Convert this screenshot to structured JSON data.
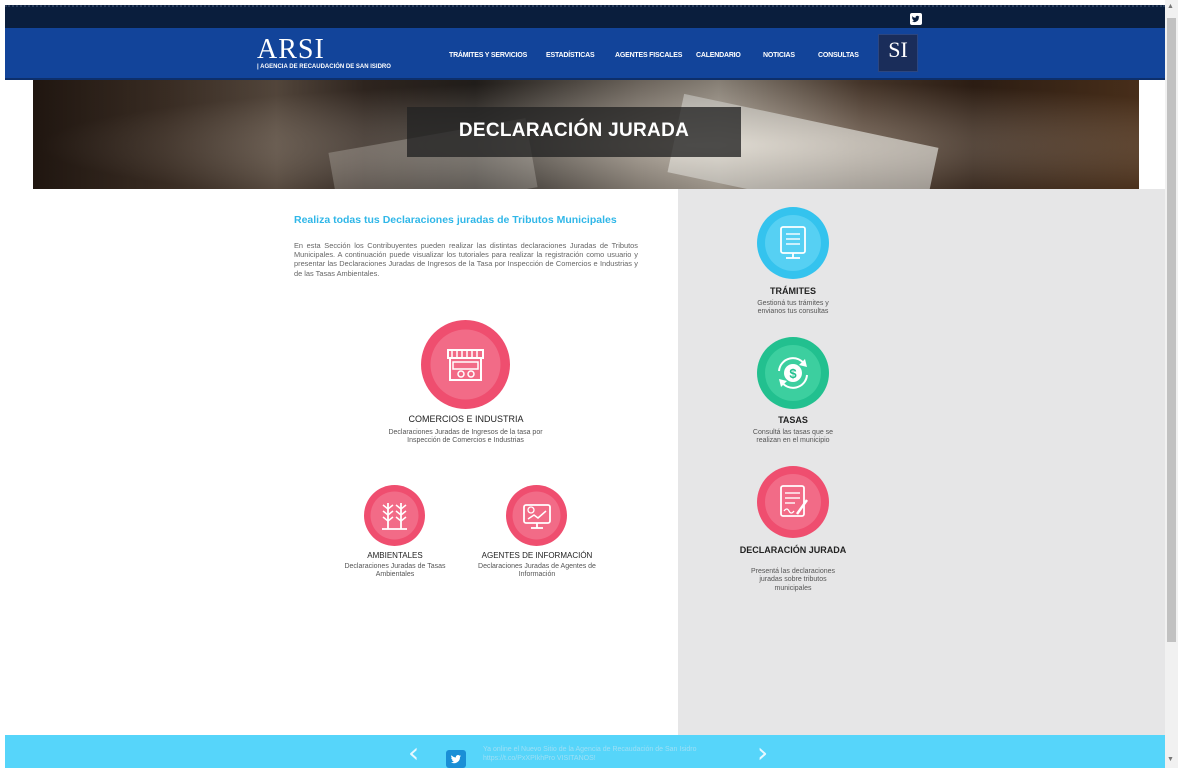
{
  "topbar": {
    "social_icon": "twitter-icon"
  },
  "header": {
    "logo_title": "ARSI",
    "logo_subtitle": "| AGENCIA DE RECAUDACIÓN DE SAN ISIDRO",
    "nav": [
      {
        "label": "TRÁMITES Y SERVICIOS"
      },
      {
        "label": "ESTADÍSTICAS"
      },
      {
        "label": "AGENTES FISCALES"
      },
      {
        "label": "CALENDARIO"
      },
      {
        "label": "NOTICIAS"
      },
      {
        "label": "CONSULTAS"
      }
    ],
    "si_logo": "SI"
  },
  "hero": {
    "title": "DECLARACIÓN JURADA"
  },
  "main": {
    "heading": "Realiza todas tus Declaraciones juradas de Tributos Municipales",
    "intro": "En esta Sección los Contribuyentes pueden realizar las distintas declaraciones Juradas de Tributos Municipales. A continuación puede visualizar los tutoriales para realizar la registración como usuario y presentar las Declaraciones Juradas de Ingresos de la Tasa por Inspección de Comercios e Industrias y de las Tasas Ambientales.",
    "cards": [
      {
        "title": "COMERCIOS E INDUSTRIA",
        "desc": "Declaraciones Juradas de Ingresos de la tasa por Inspección de Comercios e Industrias",
        "icon": "store-icon"
      },
      {
        "title": "AMBIENTALES",
        "desc": "Declaraciones Juradas de Tasas Ambientales",
        "icon": "plants-icon"
      },
      {
        "title": "AGENTES DE INFORMACIÓN",
        "desc": "Declaraciones Juradas de Agentes de Información",
        "icon": "monitor-info-icon"
      }
    ]
  },
  "sidebar": {
    "items": [
      {
        "title": "TRÁMITES",
        "desc": "Gestioná tus trámites y envianos tus consultas",
        "icon": "document-monitor-icon",
        "color": "#34c3ee"
      },
      {
        "title": "TASAS",
        "desc": "Consultá las tasas que se realizan en el municipio",
        "icon": "dollar-refresh-icon",
        "color": "#22c08f"
      },
      {
        "title": "DECLARACIÓN JURADA",
        "desc": "Presentá las declaraciones juradas sobre tributos municipales",
        "icon": "document-sign-icon",
        "color": "#ef4e6f"
      }
    ]
  },
  "footer": {
    "text": "Ya online el Nuevo Sitio de la Agencia de Recaudación de San Isidro https://t.co/PxXPIkhPro VISITANOS!",
    "prev": "‹",
    "next": "›"
  },
  "colors": {
    "nav_blue": "#12449a",
    "accent_cyan": "#30b7e8",
    "pink": "#ef4e6f",
    "footer_cyan": "#56d5fa"
  }
}
